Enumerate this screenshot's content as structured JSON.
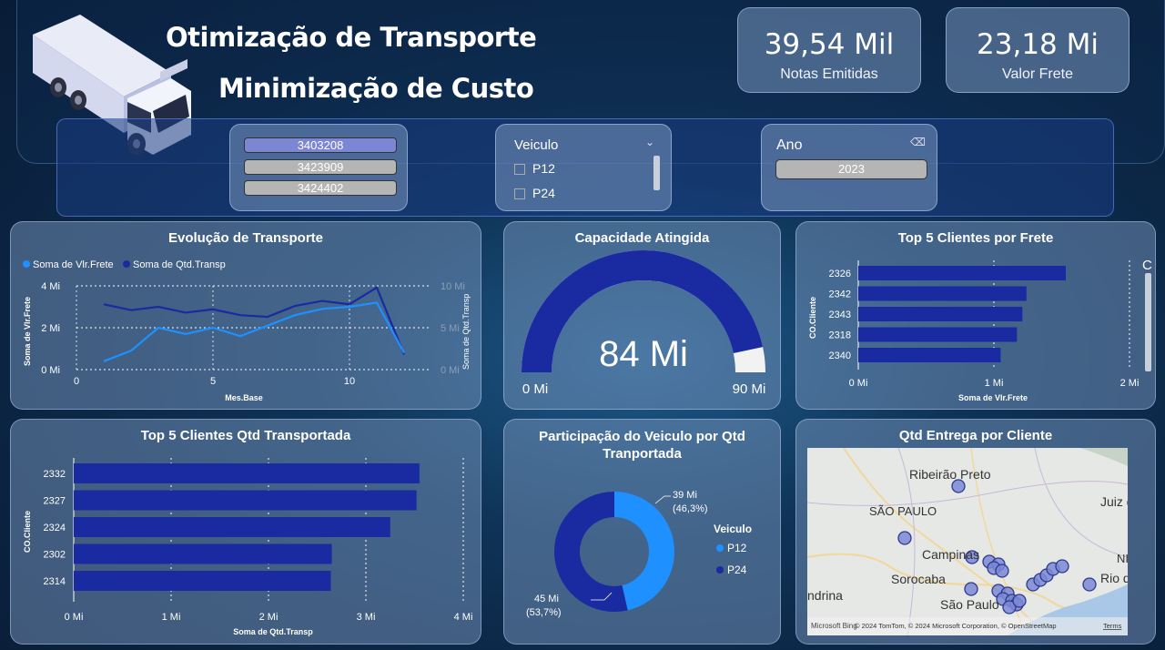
{
  "header": {
    "title_line1": "Otimização de Transporte",
    "title_line2": "Minimização de Custo"
  },
  "kpis": [
    {
      "value": "39,54 Mil",
      "label": "Notas Emitidas"
    },
    {
      "value": "23,18 Mi",
      "label": "Valor Frete"
    }
  ],
  "filters": {
    "codes": [
      {
        "label": "3403208",
        "selected": true
      },
      {
        "label": "3423909",
        "selected": false
      },
      {
        "label": "3424402",
        "selected": false
      }
    ],
    "veiculo": {
      "title": "Veiculo",
      "options": [
        "P12",
        "P24"
      ]
    },
    "ano": {
      "title": "Ano",
      "value": "2023"
    }
  },
  "colors": {
    "dark_blue": "#1a2aa0",
    "light_blue": "#1e90ff",
    "panel": "#7896be"
  },
  "chart_evolucao": {
    "title": "Evolução de Transporte",
    "legend": [
      "Soma de Vlr.Frete",
      "Soma de Qtd.Transp"
    ],
    "xlabel": "Mes.Base",
    "ylabel_left": "Soma de Vlr.Frete",
    "ylabel_right": "Soma de Qtd.Transp",
    "yticks_left": [
      "4 Mi",
      "2 Mi",
      "0 Mi"
    ],
    "yticks_right": [
      "10 Mi",
      "5 Mi",
      "0 Mi"
    ],
    "xticks": [
      "0",
      "5",
      "10"
    ],
    "chart_data": {
      "type": "line",
      "x": [
        1,
        2,
        3,
        4,
        5,
        6,
        7,
        8,
        9,
        10,
        11,
        12
      ],
      "series": [
        {
          "name": "Soma de Vlr.Frete",
          "values": [
            0.4,
            0.9,
            2.0,
            1.7,
            2.0,
            1.6,
            2.1,
            2.6,
            2.9,
            3.0,
            3.2,
            0.8
          ]
        },
        {
          "name": "Soma de Qtd.Transp",
          "values": [
            7.8,
            7.1,
            7.5,
            6.8,
            7.2,
            6.5,
            6.3,
            7.6,
            8.2,
            7.8,
            9.8,
            1.8
          ]
        }
      ],
      "ylim_left": [
        0,
        4
      ],
      "ylim_right": [
        0,
        10
      ]
    }
  },
  "gauge": {
    "title": "Capacidade Atingida",
    "value_label": "84 Mi",
    "min_label": "0 Mi",
    "max_label": "90 Mi",
    "chart_data": {
      "type": "gauge",
      "value": 84,
      "min": 0,
      "max": 90
    }
  },
  "top5_frete": {
    "title": "Top 5 Clientes por Frete",
    "ylabel": "CO.Cliente",
    "xlabel": "Soma de Vlr.Frete",
    "xticks": [
      "0 Mi",
      "1 Mi",
      "2 Mi"
    ],
    "extra_label": "C",
    "chart_data": {
      "type": "bar",
      "categories": [
        "2326",
        "2342",
        "2343",
        "2318",
        "2340"
      ],
      "values": [
        1.53,
        1.24,
        1.21,
        1.17,
        1.05
      ],
      "xlim": [
        0,
        2
      ]
    }
  },
  "top5_qtd": {
    "title": "Top 5 Clientes Qtd Transportada",
    "ylabel": "CO.Cliente",
    "xlabel": "Soma de Qtd.Transp",
    "xticks": [
      "0 Mi",
      "1 Mi",
      "2 Mi",
      "3 Mi",
      "4 Mi"
    ],
    "chart_data": {
      "type": "bar",
      "categories": [
        "2332",
        "2327",
        "2324",
        "2302",
        "2314"
      ],
      "values": [
        3.55,
        3.52,
        3.25,
        2.65,
        2.64
      ],
      "xlim": [
        0,
        4
      ]
    }
  },
  "donut": {
    "title_line1": "Participação do Veiculo por Qtd",
    "title_line2": "Tranportada",
    "legend_title": "Veiculo",
    "legend": [
      "P12",
      "P24"
    ],
    "label_p12_value": "39 Mi",
    "label_p12_pct": "(46,3%)",
    "label_p24_value": "45 Mi",
    "label_p24_pct": "(53,7%)",
    "chart_data": {
      "type": "pie",
      "categories": [
        "P12",
        "P24"
      ],
      "values": [
        39,
        45
      ]
    }
  },
  "map": {
    "title": "Qtd Entrega por Cliente",
    "places": [
      "Ribeirão Preto",
      "SÃO PAULO",
      "Campinas",
      "Sorocaba",
      "São Paulo",
      "Juiz de",
      "Rio de J",
      "ndrina",
      "NI"
    ],
    "attribution": "© 2024 TomTom, © 2024 Microsoft Corporation, © OpenStreetMap",
    "terms": "Terms",
    "brand": "Microsoft Bing"
  }
}
